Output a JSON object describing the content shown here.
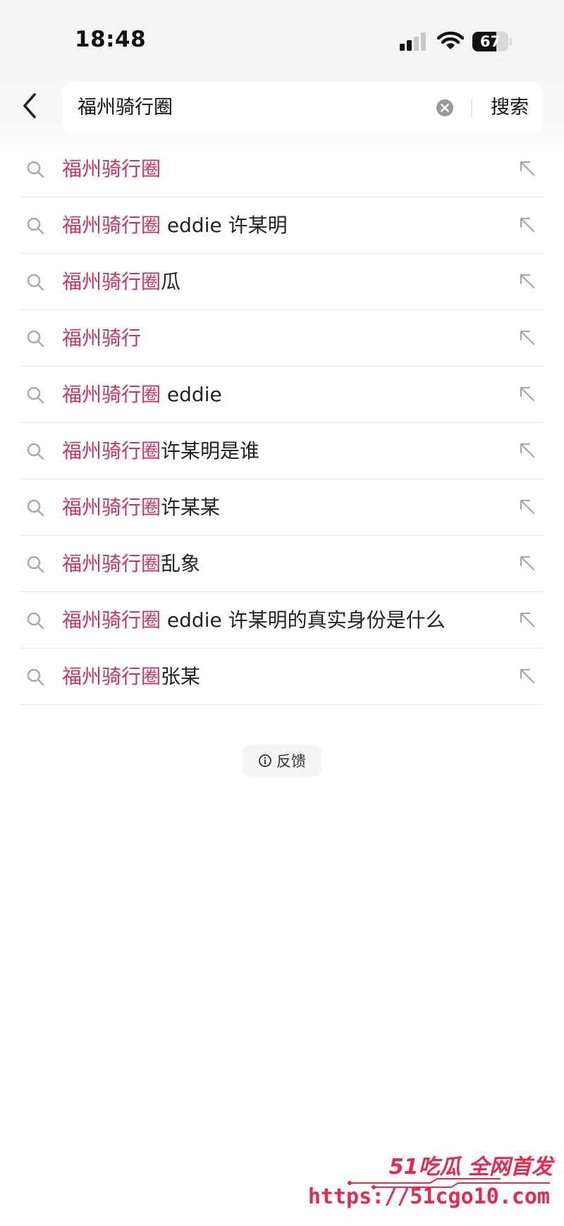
{
  "status_bar": {
    "time": "18:48",
    "battery_level": 67,
    "battery_label": "67"
  },
  "search": {
    "query": "福州骑行圈",
    "submit_label": "搜索"
  },
  "suggestions": [
    {
      "highlight": "福州骑行圈",
      "rest": ""
    },
    {
      "highlight": "福州骑行圈",
      "rest": " eddie 许某明"
    },
    {
      "highlight": "福州骑行圈",
      "rest": "瓜"
    },
    {
      "highlight": "福州骑行",
      "rest": ""
    },
    {
      "highlight": "福州骑行圈",
      "rest": " eddie"
    },
    {
      "highlight": "福州骑行圈",
      "rest": "许某明是谁"
    },
    {
      "highlight": "福州骑行圈",
      "rest": "许某某"
    },
    {
      "highlight": "福州骑行圈",
      "rest": "乱象"
    },
    {
      "highlight": "福州骑行圈",
      "rest": " eddie 许某明的真实身份是什么"
    },
    {
      "highlight": "福州骑行圈",
      "rest": "张某"
    }
  ],
  "feedback": {
    "label": "反馈"
  },
  "watermark": {
    "brand": "51吃瓜 全网首发",
    "url": "https://51cgo10.com"
  },
  "colors": {
    "highlight": "#c4365b",
    "text": "#222222",
    "watermark": "#e6294f"
  },
  "icons": {
    "suggestion": "search-icon",
    "fill": "arrow-up-left-icon",
    "back": "chevron-left-icon",
    "clear": "clear-circle-icon",
    "feedback": "info-icon"
  }
}
